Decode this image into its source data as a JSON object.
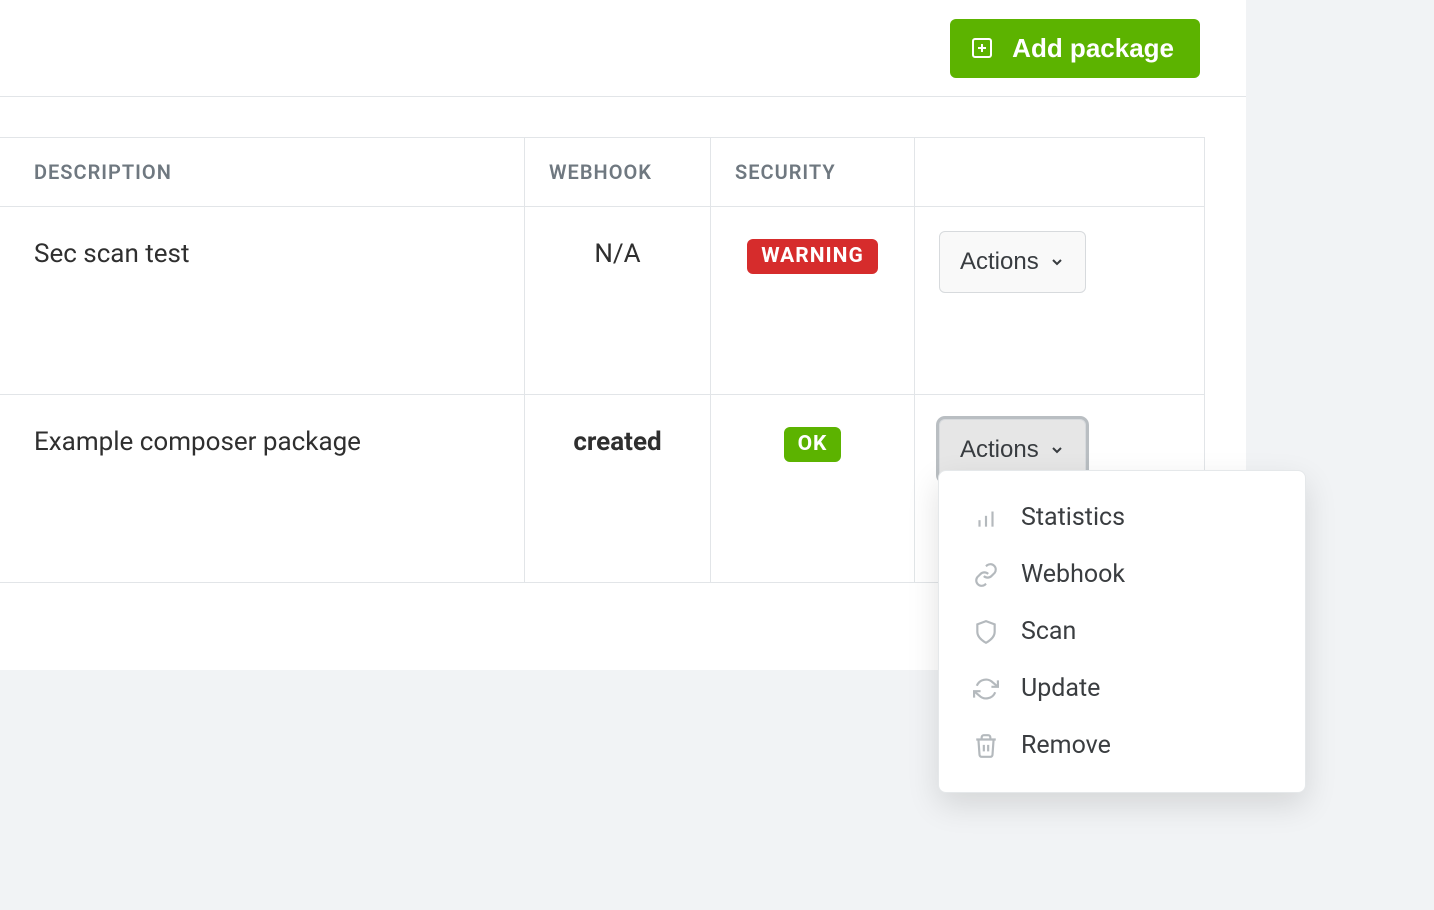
{
  "toolbar": {
    "add_label": "Add package"
  },
  "table": {
    "headers": {
      "description": "DESCRIPTION",
      "webhook": "WEBHOOK",
      "security": "SECURITY"
    },
    "rows": [
      {
        "description": "Sec scan test",
        "webhook": "N/A",
        "webhook_bold": false,
        "security_label": "WARNING",
        "security_class": "warn",
        "actions_open": false,
        "actions_label": "Actions"
      },
      {
        "description": "Example composer package",
        "webhook": "created",
        "webhook_bold": true,
        "security_label": "OK",
        "security_class": "ok",
        "actions_open": true,
        "actions_label": "Actions"
      }
    ]
  },
  "dropdown": {
    "items": [
      {
        "label": "Statistics",
        "icon": "bar-chart-icon"
      },
      {
        "label": "Webhook",
        "icon": "link-icon"
      },
      {
        "label": "Scan",
        "icon": "shield-icon"
      },
      {
        "label": "Update",
        "icon": "refresh-icon"
      },
      {
        "label": "Remove",
        "icon": "trash-icon"
      }
    ]
  }
}
